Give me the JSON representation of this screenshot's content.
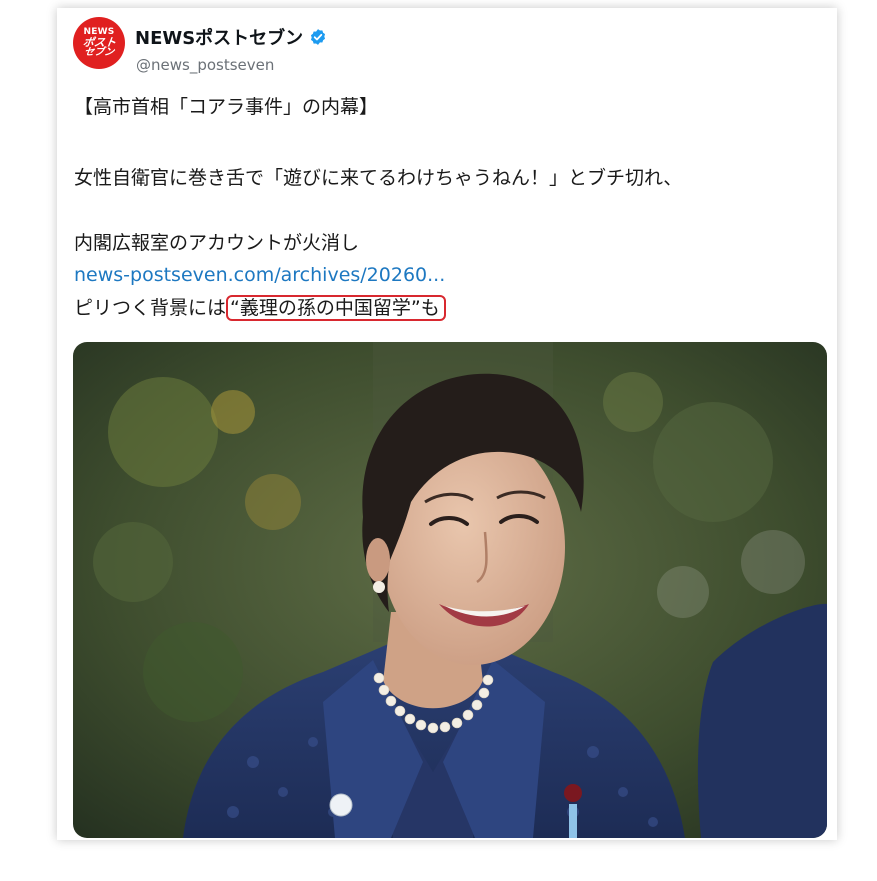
{
  "account": {
    "logo_lines": [
      "NEWS",
      "ポスト",
      "セブン"
    ],
    "display_name": "NEWSポストセブン",
    "verified_icon": "verified-badge-icon",
    "handle": "@news_postseven"
  },
  "tweet": {
    "title": "【高市首相「コアラ事件」の内幕】",
    "line2": "女性自衛官に巻き舌で「遊びに来てるわけちゃうねん！」とブチ切れ、",
    "line3": "内閣広報室のアカウントが火消し",
    "link": "news-postseven.com/archives/20260...",
    "line5_prefix": "ピリつく背景には",
    "line5_highlight": "“義理の孫の中国留学”も"
  },
  "media": {
    "type": "photo",
    "subject": "woman-portrait-photo"
  },
  "colors": {
    "accent_red": "#e02020",
    "link_blue": "#1d78c1",
    "verified_blue": "#1d9bf0",
    "highlight_red": "#d8282f"
  }
}
